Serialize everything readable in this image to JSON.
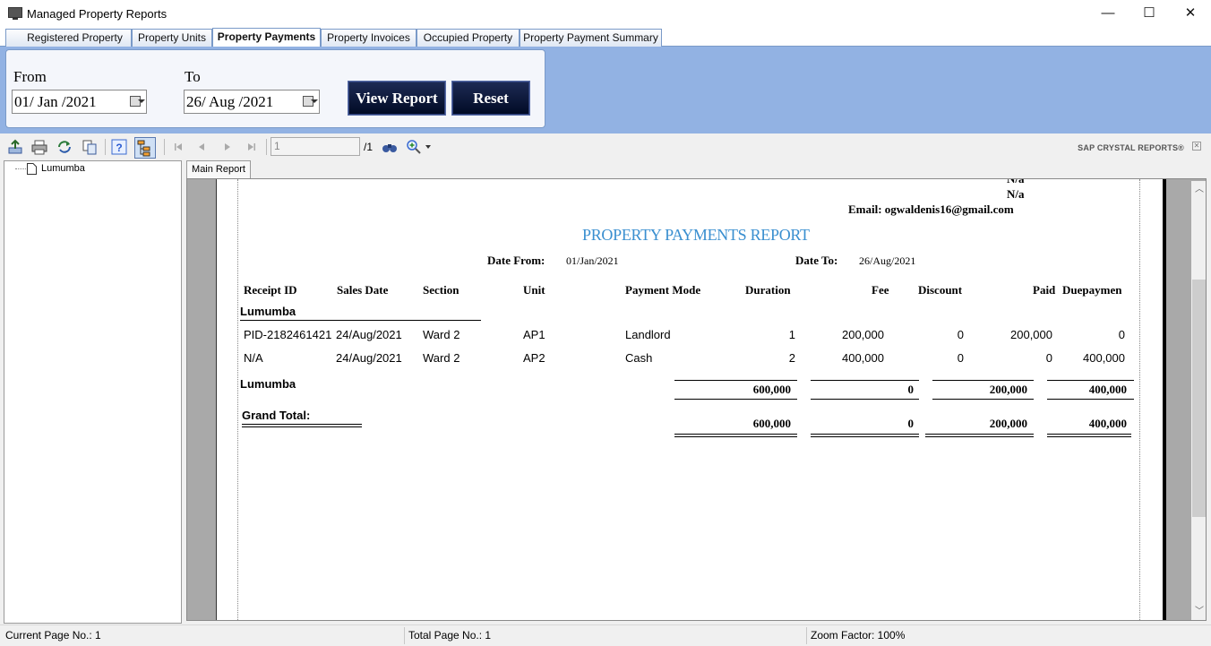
{
  "window": {
    "title": "Managed Property Reports",
    "minimize": "—",
    "maximize": "☐",
    "close": "✕"
  },
  "tabs": [
    {
      "label": "Registered Property",
      "active": false
    },
    {
      "label": "Property Units",
      "active": false
    },
    {
      "label": "Property Payments",
      "active": true
    },
    {
      "label": "Property Invoices",
      "active": false
    },
    {
      "label": "Occupied Property",
      "active": false
    },
    {
      "label": "Property Payment Summary",
      "active": false
    }
  ],
  "filters": {
    "from_label": "From",
    "from_value": "01/ Jan /2021",
    "to_label": "To",
    "to_value": "26/ Aug /2021",
    "view_report_label": "View Report",
    "reset_label": "Reset"
  },
  "toolbar": {
    "page_input": "1",
    "page_total": "/1",
    "brand": "SAP CRYSTAL REPORTS®",
    "icons": [
      "export-icon",
      "print-icon",
      "refresh-icon",
      "copy-icon",
      "help-icon",
      "group-tree-icon",
      "first-page-icon",
      "prev-page-icon",
      "next-page-icon",
      "last-page-icon",
      "find-icon",
      "zoom-icon"
    ]
  },
  "group_tree": {
    "items": [
      "Lumumba"
    ]
  },
  "main_report_tab": "Main Report",
  "report": {
    "header_right": [
      "N/a",
      "N/a"
    ],
    "email": "Email: ogwaldenis16@gmail.com",
    "title": "PROPERTY PAYMENTS REPORT",
    "date_from_label": "Date From:",
    "date_from_value": "01/Jan/2021",
    "date_to_label": "Date To:",
    "date_to_value": "26/Aug/2021",
    "columns": [
      "Receipt ID",
      "Sales Date",
      "Section",
      "Unit",
      "Payment Mode",
      "Duration",
      "Fee",
      "Discount",
      "Paid",
      "Duepaymen"
    ],
    "group_name": "Lumumba",
    "rows": [
      {
        "receipt_id": "PID-2182461421",
        "sales_date": "24/Aug/2021",
        "section": "Ward 2",
        "unit": "AP1",
        "payment_mode": "Landlord",
        "duration": "1",
        "fee": "200,000",
        "discount": "0",
        "paid": "200,000",
        "due": "0"
      },
      {
        "receipt_id": "N/A",
        "sales_date": "24/Aug/2021",
        "section": "Ward 2",
        "unit": "AP2",
        "payment_mode": "Cash",
        "duration": "2",
        "fee": "400,000",
        "discount": "0",
        "paid": "0",
        "due": "400,000"
      }
    ],
    "group_footer": {
      "label": "Lumumba",
      "fee": "600,000",
      "discount": "0",
      "paid": "200,000",
      "due": "400,000"
    },
    "grand_total": {
      "label": "Grand Total:",
      "fee": "600,000",
      "discount": "0",
      "paid": "200,000",
      "due": "400,000"
    }
  },
  "status": {
    "current_page": "Current Page No.: 1",
    "total_page": "Total Page No.: 1",
    "zoom": "Zoom Factor: 100%"
  }
}
